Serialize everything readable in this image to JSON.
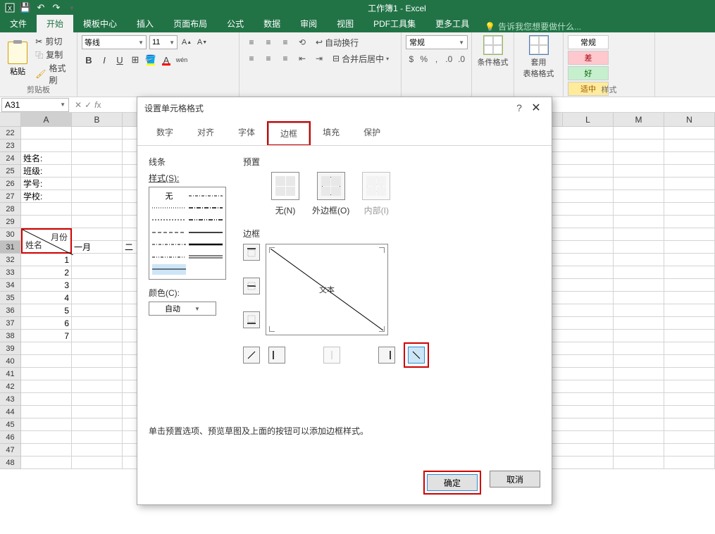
{
  "titlebar": {
    "title": "工作簿1 - Excel"
  },
  "tabs": {
    "file": "文件",
    "home": "开始",
    "template": "模板中心",
    "insert": "插入",
    "pagelayout": "页面布局",
    "formulas": "公式",
    "data": "数据",
    "review": "审阅",
    "view": "视图",
    "pdftools": "PDF工具集",
    "more": "更多工具",
    "tellme": "告诉我您想要做什么..."
  },
  "ribbon": {
    "paste": "粘贴",
    "cut": "剪切",
    "copy": "复制",
    "format_painter": "格式刷",
    "clipboard_label": "剪贴板",
    "font_name": "等线",
    "font_size": "11",
    "wrap": "自动换行",
    "merge": "合并后居中",
    "number_fmt": "常规",
    "cond_fmt": "条件格式",
    "tbl_fmt": "套用\n表格格式",
    "style_normal": "常规",
    "style_bad": "差",
    "style_good": "好",
    "style_neutral": "适中",
    "styles_label": "样式"
  },
  "namebox": "A31",
  "columns": {
    "A": "A",
    "B": "B",
    "L": "L",
    "M": "M",
    "N": "N"
  },
  "rows": {
    "r22": "22",
    "r23": "23",
    "r24": "24",
    "r25": "25",
    "r26": "26",
    "r27": "27",
    "r28": "28",
    "r29": "29",
    "r30": "30",
    "r31": "31",
    "r32": "32",
    "r33": "33",
    "r34": "34",
    "r35": "35",
    "r36": "36",
    "r37": "37",
    "r38": "38",
    "r39": "39",
    "r40": "40",
    "r41": "41",
    "r42": "42",
    "r43": "43",
    "r44": "44",
    "r45": "45",
    "r46": "46",
    "r47": "47",
    "r48": "48"
  },
  "cells": {
    "a24": "姓名:",
    "a25": "班级:",
    "a26": "学号:",
    "a27": "学校:",
    "diag_month": "月份",
    "diag_name": "姓名",
    "b31": "一月",
    "b31_next": "二",
    "a32": "1",
    "a33": "2",
    "a34": "3",
    "a35": "4",
    "a36": "5",
    "a37": "6",
    "a38": "7"
  },
  "dialog": {
    "title": "设置单元格格式",
    "tabs": {
      "number": "数字",
      "align": "对齐",
      "font": "字体",
      "border": "边框",
      "fill": "填充",
      "protect": "保护"
    },
    "line_section": "线条",
    "style_label": "样式(S):",
    "style_none": "无",
    "color_label": "颜色(C):",
    "color_auto": "自动",
    "preset_section": "预置",
    "preset_none": "无(N)",
    "preset_outline": "外边框(O)",
    "preset_inside": "内部(I)",
    "border_section": "边框",
    "preview_text": "文本",
    "hint": "单击预置选项、预览草图及上面的按钮可以添加边框样式。",
    "ok": "确定",
    "cancel": "取消"
  }
}
